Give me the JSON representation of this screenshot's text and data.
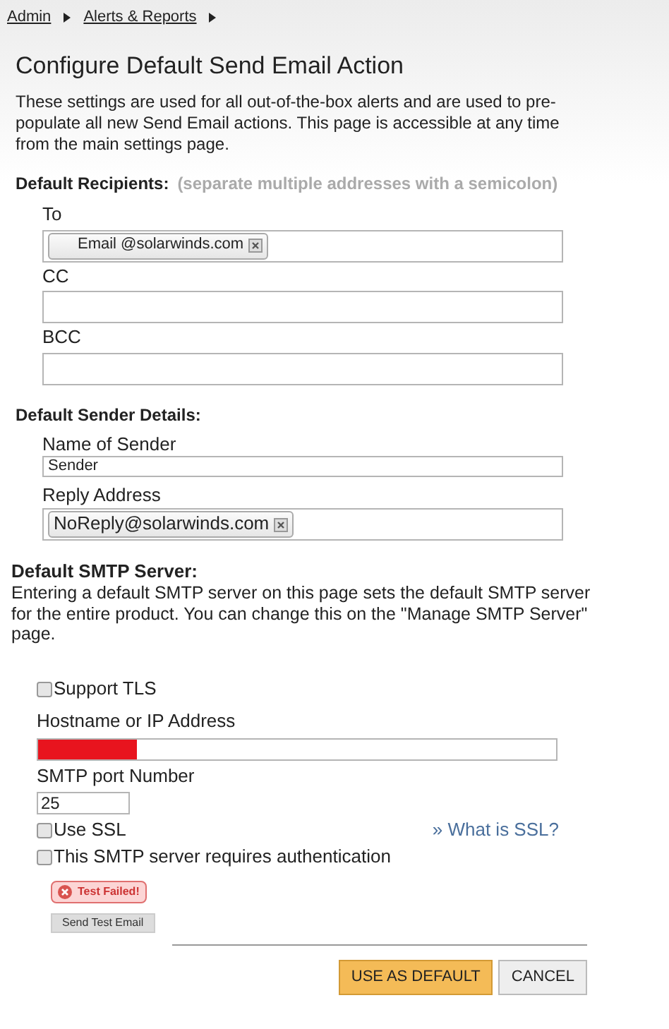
{
  "breadcrumb": [
    {
      "label": "Admin"
    },
    {
      "label": "Alerts & Reports"
    }
  ],
  "title": "Configure Default Send Email Action",
  "description": "These settings are used for all out-of-the-box alerts and are used to pre-populate all new Send Email actions. This page is accessible at any time from the main settings page.",
  "recipients": {
    "heading": "Default Recipients:",
    "hint": "(separate multiple addresses with a semicolon)",
    "fields": [
      {
        "label": "To",
        "tokens": [
          "Email @solarwinds.com"
        ]
      },
      {
        "label": "CC"
      },
      {
        "label": "BCC"
      }
    ]
  },
  "sender": {
    "heading": "Default Sender Details:",
    "fields": [
      {
        "label": "Name of Sender",
        "kind": "text",
        "value": "Sender"
      },
      {
        "label": "Reply Address",
        "kind": "tokens",
        "tokens": [
          "NoReply@solarwinds.com"
        ]
      }
    ]
  },
  "smtp": {
    "heading": "Default SMTP Server:",
    "description": "Entering a default SMTP server on this page sets the default SMTP server for the entire product. You can change this on the \"Manage SMTP Server\" page.",
    "support_tls": {
      "label": "Support TLS",
      "checked": false
    },
    "hostname": {
      "label": "Hostname or IP Address",
      "redacted": true
    },
    "port": {
      "label": "SMTP port Number",
      "value": "25"
    },
    "use_ssl": {
      "label": "Use SSL",
      "checked": false
    },
    "ssl_link": "» What is SSL?",
    "auth": {
      "label": "This SMTP server requires authentication",
      "checked": false
    },
    "test_status": "Test Failed!",
    "test_button": "Send Test Email"
  },
  "buttons": [
    {
      "label": "USE AS DEFAULT",
      "kind": "primary"
    },
    {
      "label": "CANCEL",
      "kind": "secondary"
    }
  ]
}
